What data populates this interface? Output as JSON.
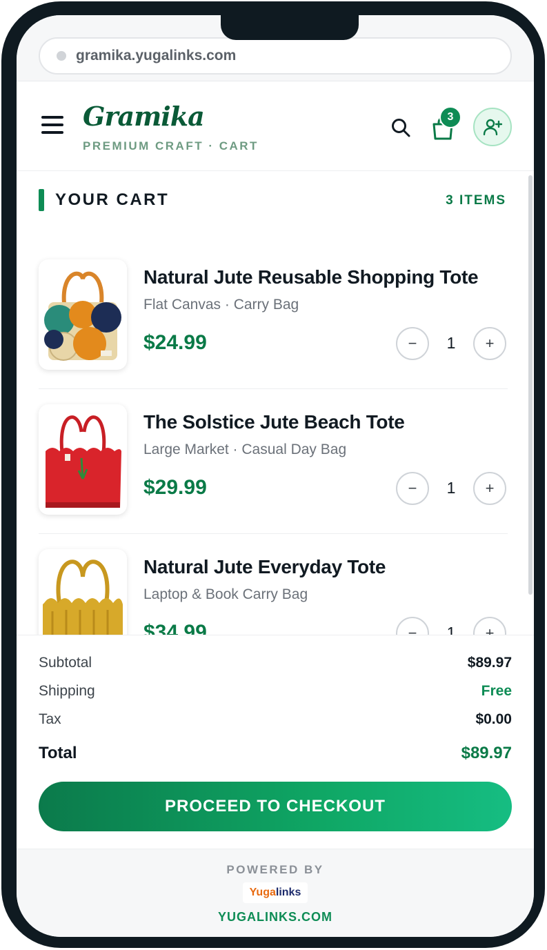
{
  "browser": {
    "url": "gramika.yugalinks.com"
  },
  "header": {
    "brand": "Gramika",
    "tagline": "PREMIUM CRAFT · CART",
    "cart_badge": "3"
  },
  "cart": {
    "title": "YOUR CART",
    "item_count": "3 ITEMS",
    "items": [
      {
        "name": "Natural Jute Reusable Shopping Tote",
        "subtitle": "Flat Canvas · Carry Bag",
        "price": "$24.99",
        "qty": "1",
        "minus": "−",
        "plus": "+"
      },
      {
        "name": "The Solstice Jute Beach Tote",
        "subtitle": "Large Market · Casual Day Bag",
        "price": "$29.99",
        "qty": "1",
        "minus": "−",
        "plus": "+"
      },
      {
        "name": "Natural Jute Everyday Tote",
        "subtitle": "Laptop & Book Carry Bag",
        "price": "$34.99",
        "qty": "1",
        "minus": "−",
        "plus": "+"
      }
    ]
  },
  "summary": {
    "subtotal_label": "Subtotal",
    "subtotal_value": "$89.97",
    "shipping_label": "Shipping",
    "shipping_value": "Free",
    "tax_label": "Tax",
    "tax_value": "$0.00",
    "total_label": "Total",
    "total_value": "$89.97",
    "checkout_label": "PROCEED TO CHECKOUT"
  },
  "footer": {
    "powered_by": "POWERED BY",
    "logo_part1": "Yuga",
    "logo_part2": "links",
    "url": "YUGALINKS.COM"
  },
  "colors": {
    "brand_green": "#0a7a47",
    "accent_green": "#0e8c55",
    "text_dark": "#111a22"
  },
  "icons": [
    "menu-icon",
    "search-icon",
    "shopping-bag-icon",
    "add-user-icon"
  ]
}
